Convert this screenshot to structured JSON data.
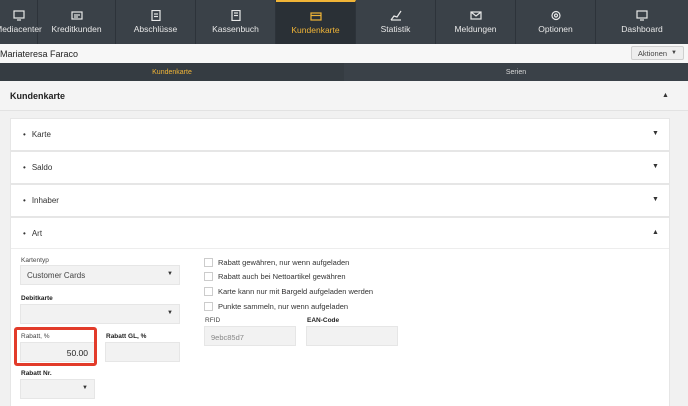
{
  "nav": [
    {
      "label": "Mediacenter",
      "icon": "monitor-icon",
      "width": 38
    },
    {
      "label": "Kreditkunden",
      "icon": "card-icon",
      "width": 78
    },
    {
      "label": "Abschlüsse",
      "icon": "document-icon",
      "width": 80
    },
    {
      "label": "Kassenbuch",
      "icon": "book-icon",
      "width": 80
    },
    {
      "label": "Kundenkarte",
      "icon": "customer-card-icon",
      "width": 80
    },
    {
      "label": "Statistik",
      "icon": "chart-icon",
      "width": 80
    },
    {
      "label": "Meldungen",
      "icon": "mail-icon",
      "width": 80
    },
    {
      "label": "Optionen",
      "icon": "gear-icon",
      "width": 80
    },
    {
      "label": "Dashboard",
      "icon": "dashboard-icon",
      "width": 92
    }
  ],
  "header": {
    "title": "Mariateresa Faraco",
    "actions_label": "Aktionen",
    "actions_arrow": "▼"
  },
  "subtabs": [
    "Kundenkarte",
    "Serien"
  ],
  "section": {
    "title": "Kundenkarte",
    "caret": "▲"
  },
  "panels": {
    "karte": {
      "title": "Karte",
      "caret": "▼"
    },
    "saldo": {
      "title": "Saldo",
      "caret": "▼"
    },
    "inhaber": {
      "title": "Inhaber",
      "caret": "▼"
    },
    "art": {
      "title": "Art",
      "caret": "▲"
    }
  },
  "form": {
    "kartentyp_label": "Kartentyp",
    "kartentyp_value": "Customer Cards",
    "debitkarte_label": "Debitkarte",
    "debitkarte_value": "",
    "rabatt_label": "Rabatt, %",
    "rabatt_value": "50.00",
    "rabatt_gl_label": "Rabatt GL, %",
    "rabatt_gl_value": "",
    "rabatt_nr_label": "Rabatt Nr.",
    "rfid_label": "RFID",
    "rfid_value": "9ebc85d7",
    "ean_label": "EAN-Code",
    "ean_value": "",
    "select_arrow": "▼",
    "checkboxes": [
      {
        "label": "Rabatt gewähren, nur wenn aufgeladen",
        "checked": false
      },
      {
        "label": "Rabatt auch bei Nettoartikel gewähren",
        "checked": false
      },
      {
        "label": "Karte kann nur mit Bargeld aufgeladen werden",
        "checked": false
      },
      {
        "label": "Punkte sammeln, nur wenn aufgeladen",
        "checked": false
      }
    ]
  },
  "colors": {
    "nav_bg": "#3a4148",
    "accent": "#f0b437",
    "highlight": "#e23b2a"
  }
}
